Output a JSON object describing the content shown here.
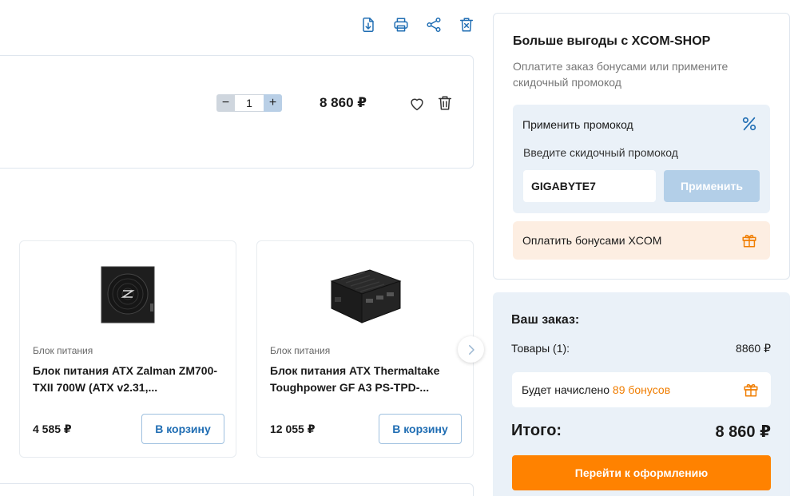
{
  "toolbar": {
    "icons": [
      "download-pdf-icon",
      "print-icon",
      "share-icon",
      "clear-cart-icon"
    ]
  },
  "cart_item": {
    "quantity": "1",
    "minus": "−",
    "plus": "+",
    "price": "8 860 ₽"
  },
  "recommendations": [
    {
      "category": "Блок питания",
      "name": "Блок питания ATX Zalman ZM700-TXII 700W (ATX v2.31,...",
      "price": "4 585 ₽",
      "button": "В корзину"
    },
    {
      "category": "Блок питания",
      "name": "Блок питания ATX Thermaltake Toughpower GF A3 PS-TPD-...",
      "price": "12 055 ₽",
      "button": "В корзину"
    }
  ],
  "promo_panel": {
    "title": "Больше выгоды с XCOM-SHOP",
    "subtitle": "Оплатите заказ бонусами или примените скидочный промокод",
    "promo_title": "Применить промокод",
    "promo_hint": "Введите скидочный промокод",
    "promo_value": "GIGABYTE7",
    "apply": "Применить",
    "bonus_label": "Оплатить бонусами XCOM"
  },
  "order": {
    "title": "Ваш заказ:",
    "items_label": "Товары (1):",
    "items_value": "8860 ₽",
    "bonus_prefix": "Будет начислено ",
    "bonus_link": "89 бонусов",
    "total_label": "Итого:",
    "total_value": "8 860 ₽",
    "checkout": "Перейти к оформлению"
  },
  "colors": {
    "accent_blue": "#1f6db3",
    "accent_orange": "#ff8200",
    "panel_blue": "#eaf1f8",
    "panel_peach": "#fdeee2"
  }
}
